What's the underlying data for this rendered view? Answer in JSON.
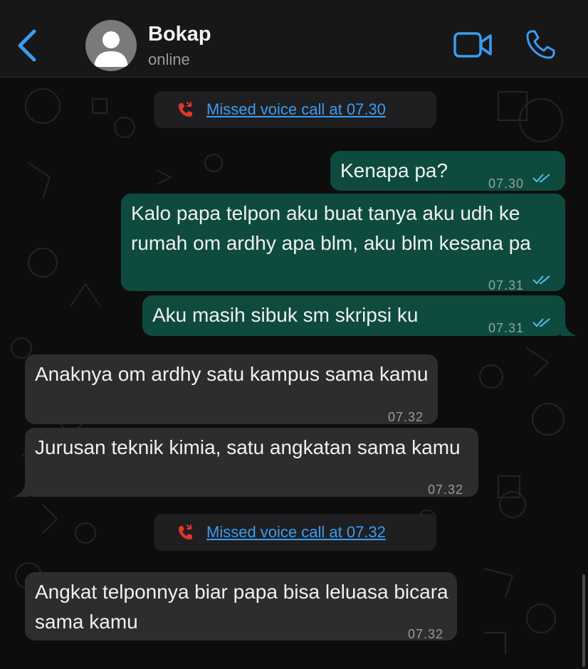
{
  "header": {
    "contact_name": "Bokap",
    "status": "online"
  },
  "colors": {
    "accent": "#3b9cf2",
    "outgoing_bubble": "#0e4b3e",
    "incoming_bubble": "#2d2d2f",
    "missed_call_icon": "#e5352b"
  },
  "messages": [
    {
      "type": "system",
      "icon": "missed-call-icon",
      "text": "Missed voice call at 07.30"
    },
    {
      "type": "outgoing",
      "text": "Kenapa pa?",
      "time": "07.30",
      "status": "read"
    },
    {
      "type": "outgoing",
      "text": "Kalo papa telpon aku buat tanya aku udh ke rumah om ardhy apa blm, aku blm kesana pa",
      "time": "07.31",
      "status": "read"
    },
    {
      "type": "outgoing",
      "text": "Aku masih sibuk sm skripsi ku",
      "time": "07.31",
      "status": "read"
    },
    {
      "type": "incoming",
      "text": "Anaknya om ardhy satu kampus sama kamu",
      "time": "07.32"
    },
    {
      "type": "incoming",
      "text": "Jurusan teknik kimia, satu angkatan sama kamu",
      "time": "07.32"
    },
    {
      "type": "system",
      "icon": "missed-call-icon",
      "text": "Missed voice call at 07.32"
    },
    {
      "type": "incoming",
      "text": "Angkat telponnya biar papa bisa leluasa bicara sama kamu",
      "time": "07.32"
    }
  ]
}
